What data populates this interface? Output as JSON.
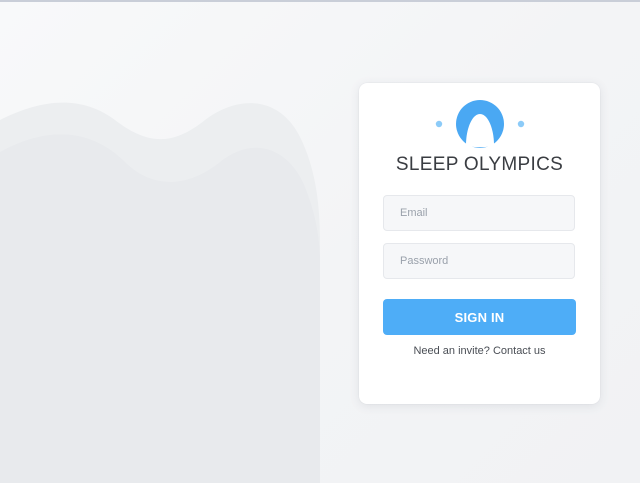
{
  "brand": {
    "name": "SLEEP OLYMPICS",
    "logo_icon": "moon-sleep-icon"
  },
  "login": {
    "email_placeholder": "Email",
    "password_placeholder": "Password",
    "submit_label": "SIGN IN",
    "invite_text": "Need an invite?",
    "contact_link": "Contact us"
  },
  "colors": {
    "accent": "#4eadf7",
    "logo_blue": "#4aa8f3",
    "logo_dot": "#8ccbf8",
    "card_bg": "#ffffff",
    "page_bg": "#f3f4f6"
  }
}
